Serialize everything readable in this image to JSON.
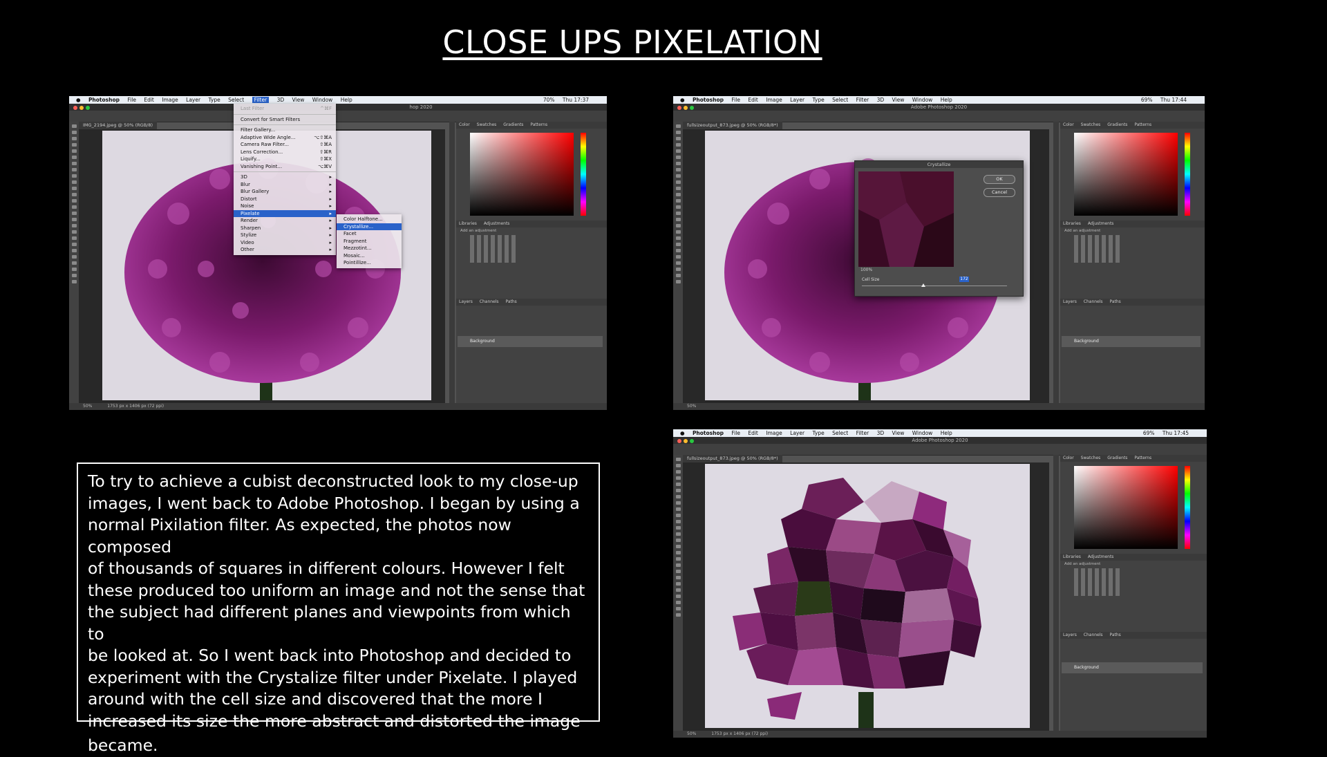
{
  "title": "CLOSE UPS PIXELATION",
  "body_text_lines": [
    "To try to achieve a cubist deconstructed look to my close-up",
    "images, I went back to Adobe Photoshop.  I began by using a",
    "normal Pixilation filter. As expected, the photos now composed",
    "of thousands of squares in different colours. However I felt",
    "these produced too uniform an image and not the sense that",
    "the subject had different planes and viewpoints from which to",
    "be looked at. So I went back into Photoshop and decided to",
    "experiment with the Crystalize filter under Pixelate. I  played",
    "around with the cell size and discovered that the more I",
    "increased its size the more  abstract and distorted the image",
    "became."
  ],
  "colors": {
    "flower": "#8a1f7a",
    "flower_dark": "#4a0c3f",
    "stem": "#1e3318",
    "menu_highlight": "#2a62c9",
    "ps_panel": "#424242"
  },
  "screenshot1": {
    "menu": [
      "Photoshop",
      "File",
      "Edit",
      "Image",
      "Layer",
      "Type",
      "Select",
      "Filter",
      "3D",
      "View",
      "Window",
      "Help"
    ],
    "clock": "Thu 17:37",
    "battery": "70%",
    "window_title": "hop 2020",
    "tab": "IMG_2194.jpeg @ 50% (RGB/8)",
    "filter_menu": [
      {
        "label": "Last Filter",
        "shortcut": "^⌘F",
        "state": "disabled"
      },
      {
        "sep": true
      },
      {
        "label": "Convert for Smart Filters"
      },
      {
        "sep": true
      },
      {
        "label": "Filter Gallery..."
      },
      {
        "label": "Adaptive Wide Angle...",
        "shortcut": "⌥⇧⌘A"
      },
      {
        "label": "Camera Raw Filter...",
        "shortcut": "⇧⌘A"
      },
      {
        "label": "Lens Correction...",
        "shortcut": "⇧⌘R"
      },
      {
        "label": "Liquify...",
        "shortcut": "⇧⌘X"
      },
      {
        "label": "Vanishing Point...",
        "shortcut": "⌥⌘V"
      },
      {
        "sep": true
      },
      {
        "label": "3D",
        "shortcut": "▸"
      },
      {
        "label": "Blur",
        "shortcut": "▸"
      },
      {
        "label": "Blur Gallery",
        "shortcut": "▸"
      },
      {
        "label": "Distort",
        "shortcut": "▸"
      },
      {
        "label": "Noise",
        "shortcut": "▸"
      },
      {
        "label": "Pixelate",
        "shortcut": "▸",
        "state": "selected"
      },
      {
        "label": "Render",
        "shortcut": "▸"
      },
      {
        "label": "Sharpen",
        "shortcut": "▸"
      },
      {
        "label": "Stylize",
        "shortcut": "▸"
      },
      {
        "label": "Video",
        "shortcut": "▸"
      },
      {
        "label": "Other",
        "shortcut": "▸"
      }
    ],
    "pixelate_submenu": [
      {
        "label": "Color Halftone..."
      },
      {
        "label": "Crystallize...",
        "state": "selected"
      },
      {
        "label": "Facet"
      },
      {
        "label": "Fragment"
      },
      {
        "label": "Mezzotint..."
      },
      {
        "label": "Mosaic..."
      },
      {
        "label": "Pointillize..."
      }
    ],
    "panel_tabs": [
      "Color",
      "Swatches",
      "Gradients",
      "Patterns"
    ],
    "adj_tabs": [
      "Libraries",
      "Adjustments"
    ],
    "adj_hint": "Add an adjustment",
    "layer_tabs": [
      "Layers",
      "Channels",
      "Paths"
    ],
    "layer_name": "Background",
    "status": "1753 px x 1406 px (72 ppi)",
    "zoom": "50%"
  },
  "screenshot2": {
    "menu": [
      "Photoshop",
      "File",
      "Edit",
      "Image",
      "Layer",
      "Type",
      "Select",
      "Filter",
      "3D",
      "View",
      "Window",
      "Help"
    ],
    "clock": "Thu 17:44",
    "battery": "69%",
    "window_title": "Adobe Photoshop 2020",
    "tab": "fullsizeoutput_873.jpeg @ 50% (RGB/8*)",
    "dialog": {
      "title": "Crystallize",
      "ok": "OK",
      "cancel": "Cancel",
      "zoom": "100%",
      "cell_size_label": "Cell Size",
      "cell_size_value": "172"
    },
    "panel_tabs": [
      "Color",
      "Swatches",
      "Gradients",
      "Patterns"
    ],
    "adj_tabs": [
      "Libraries",
      "Adjustments"
    ],
    "adj_hint": "Add an adjustment",
    "layer_tabs": [
      "Layers",
      "Channels",
      "Paths"
    ],
    "layer_name": "Background",
    "zoom": "50%"
  },
  "screenshot3": {
    "menu": [
      "Photoshop",
      "File",
      "Edit",
      "Image",
      "Layer",
      "Type",
      "Select",
      "Filter",
      "3D",
      "View",
      "Window",
      "Help"
    ],
    "clock": "Thu 17:45",
    "battery": "69%",
    "window_title": "Adobe Photoshop 2020",
    "tab": "fullsizeoutput_873.jpeg @ 50% (RGB/8*)",
    "panel_tabs": [
      "Color",
      "Swatches",
      "Gradients",
      "Patterns"
    ],
    "adj_tabs": [
      "Libraries",
      "Adjustments"
    ],
    "adj_hint": "Add an adjustment",
    "layer_tabs": [
      "Layers",
      "Channels",
      "Paths"
    ],
    "layer_name": "Background",
    "status": "1753 px x 1406 px (72 ppi)",
    "zoom": "50%"
  }
}
